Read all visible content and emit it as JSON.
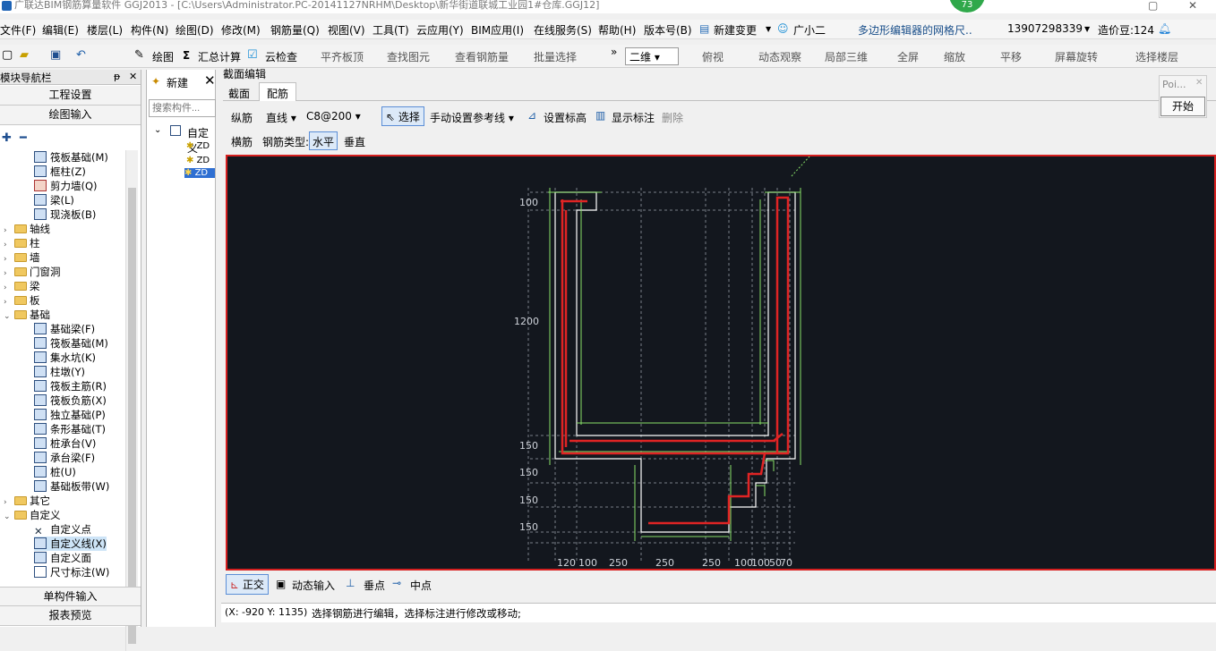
{
  "window": {
    "title": "广联达BIM钢筋算量软件 GGJ2013 - [C:\\Users\\Administrator.PC-20141127NRHM\\Desktop\\新华街道联城工业园1#仓库.GGJ12]",
    "badge": "73"
  },
  "menu": {
    "items": [
      "文件(F)",
      "编辑(E)",
      "楼层(L)",
      "构件(N)",
      "绘图(D)",
      "修改(M)",
      "钢筋量(Q)",
      "视图(V)",
      "工具(T)",
      "云应用(Y)",
      "BIM应用(I)",
      "在线服务(S)",
      "帮助(H)",
      "版本号(B)",
      "新建变更",
      "广小二",
      "多边形编辑器的网格尺..",
      "13907298339",
      "造价豆:124"
    ]
  },
  "toolbar": {
    "draw": "绘图",
    "sum_icon": "Σ",
    "sum": "汇总计算",
    "cloud_check": "云检查",
    "level_top": "平齐板顶",
    "find": "查找图元",
    "view_rebar": "查看钢筋量",
    "batch_select": "批量选择",
    "chev": "»",
    "view_mode": "二维",
    "top_view": "俯视",
    "dynamic": "动态观察",
    "local3d": "局部三维",
    "fullscreen": "全屏",
    "zoom": "缩放",
    "pan": "平移",
    "rotate": "屏幕旋转",
    "select_floor": "选择楼层"
  },
  "leftpanel": {
    "title": "模块导航栏",
    "pin": "ᵽ",
    "close": "✕",
    "project_settings": "工程设置",
    "drawing_input": "绘图输入",
    "single_input": "单构件输入",
    "report": "报表预览",
    "tree": [
      {
        "label": "筏板基础(M)",
        "level": 2
      },
      {
        "label": "框柱(Z)",
        "level": 2
      },
      {
        "label": "剪力墙(Q)",
        "level": 2
      },
      {
        "label": "梁(L)",
        "level": 2
      },
      {
        "label": "现浇板(B)",
        "level": 2
      },
      {
        "label": "轴线",
        "level": 1
      },
      {
        "label": "柱",
        "level": 1
      },
      {
        "label": "墙",
        "level": 1
      },
      {
        "label": "门窗洞",
        "level": 1
      },
      {
        "label": "梁",
        "level": 1
      },
      {
        "label": "板",
        "level": 1
      },
      {
        "label": "基础",
        "level": 1
      },
      {
        "label": "基础梁(F)",
        "level": 2
      },
      {
        "label": "筏板基础(M)",
        "level": 2
      },
      {
        "label": "集水坑(K)",
        "level": 2
      },
      {
        "label": "柱墩(Y)",
        "level": 2
      },
      {
        "label": "筏板主筋(R)",
        "level": 2
      },
      {
        "label": "筏板负筋(X)",
        "level": 2
      },
      {
        "label": "独立基础(P)",
        "level": 2
      },
      {
        "label": "条形基础(T)",
        "level": 2
      },
      {
        "label": "桩承台(V)",
        "level": 2
      },
      {
        "label": "承台梁(F)",
        "level": 2
      },
      {
        "label": "桩(U)",
        "level": 2
      },
      {
        "label": "基础板带(W)",
        "level": 2
      },
      {
        "label": "其它",
        "level": 1
      },
      {
        "label": "自定义",
        "level": 1
      },
      {
        "label": "自定义点",
        "level": 2
      },
      {
        "label": "自定义线(X)",
        "level": 2
      },
      {
        "label": "自定义面",
        "level": 2
      },
      {
        "label": "尺寸标注(W)",
        "level": 2
      }
    ]
  },
  "midpanel": {
    "new": "新建",
    "search_placeholder": "搜索构件...",
    "root": "自定义",
    "items": [
      "ZD",
      "ZD",
      "ZD"
    ]
  },
  "editor": {
    "title": "截面编辑",
    "tab1": "截面",
    "tab2": "配筋",
    "longbar": "纵筋",
    "line": "直线",
    "spec": "C8@200",
    "select": "选择",
    "manual_ref": "手动设置参考线",
    "set_elev": "设置标高",
    "show_dim": "显示标注",
    "delete": "删除",
    "stirrup": "横筋",
    "bar_type": "钢筋类型:",
    "horizontal": "水平",
    "vertical": "垂直"
  },
  "cad": {
    "dims_left": [
      "100",
      "1200",
      "150",
      "150",
      "150",
      "150"
    ],
    "dims_bottom": [
      "120",
      "100",
      "250",
      "250",
      "250",
      "100",
      "100",
      "50",
      "70"
    ]
  },
  "bottom": {
    "ortho": "正交",
    "dynamic_input": "动态输入",
    "perp": "垂点",
    "mid": "中点"
  },
  "status": {
    "coords": "(X: -920 Y: 1135)",
    "message": "选择钢筋进行编辑，选择标注进行修改或移动;"
  },
  "popup": {
    "title": "Poi...",
    "start": "开始"
  }
}
